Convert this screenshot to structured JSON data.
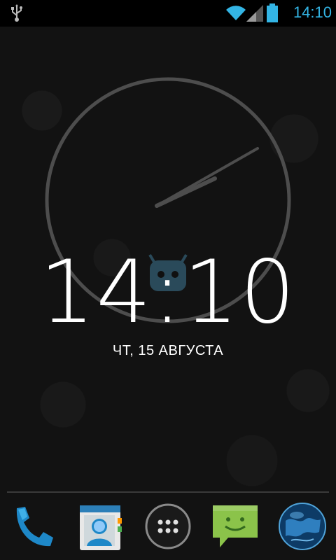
{
  "status_bar": {
    "time": "14:10",
    "icons": [
      "usb-icon",
      "wifi-icon",
      "signal-icon",
      "battery-icon"
    ],
    "accent_color": "#33b5e5"
  },
  "clock": {
    "time": "14:10",
    "date": "ЧТ, 15 АВГУСТА"
  },
  "dock": {
    "apps": [
      "phone-icon",
      "contacts-icon",
      "app-drawer-icon",
      "messaging-icon",
      "browser-icon"
    ]
  }
}
